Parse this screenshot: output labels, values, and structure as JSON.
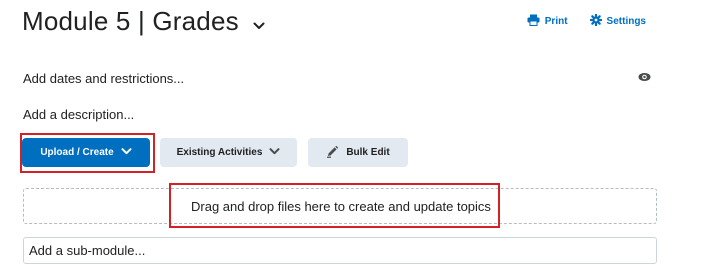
{
  "header": {
    "title": "Module 5 | Grades",
    "print_label": "Print",
    "settings_label": "Settings"
  },
  "module": {
    "dates_link": "Add dates and restrictions...",
    "description_link": "Add a description..."
  },
  "actions": {
    "upload_label": "Upload / Create",
    "existing_label": "Existing Activities",
    "bulk_edit_label": "Bulk Edit"
  },
  "dropzone": {
    "text": "Drag and drop files here to create and update topics"
  },
  "submodule": {
    "placeholder": "Add a sub-module..."
  },
  "colors": {
    "accent": "#006fbf",
    "highlight": "#d42027"
  },
  "icons": [
    "chevron-down-icon",
    "printer-icon",
    "gear-icon",
    "eye-icon",
    "pencil-icon"
  ]
}
